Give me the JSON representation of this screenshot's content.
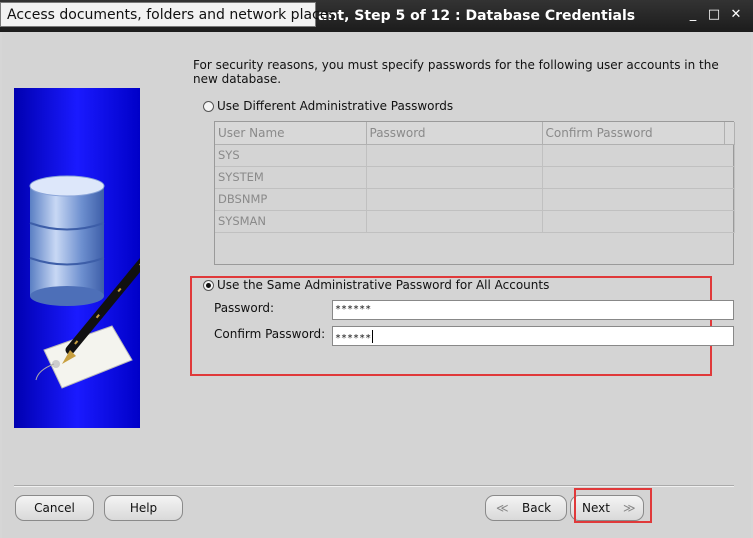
{
  "window": {
    "title": "ant, Step 5 of 12 : Database Credentials",
    "tooltip": "Access documents, folders and network places",
    "minimize_glyph": "_",
    "maximize_glyph": "□",
    "close_glyph": "✕"
  },
  "intro_text": "For security reasons, you must specify passwords for the following user accounts in the new database.",
  "option_different": {
    "label": "Use Different Administrative Passwords",
    "selected": false
  },
  "accounts_table": {
    "columns": [
      "User Name",
      "Password",
      "Confirm Password"
    ],
    "rows": [
      [
        "SYS",
        "",
        ""
      ],
      [
        "SYSTEM",
        "",
        ""
      ],
      [
        "DBSNMP",
        "",
        ""
      ],
      [
        "SYSMAN",
        "",
        ""
      ]
    ]
  },
  "option_same": {
    "label": "Use the Same Administrative Password for All Accounts",
    "selected": true,
    "password_label": "Password:",
    "password_value": "******",
    "confirm_label": "Confirm Password:",
    "confirm_value": "******"
  },
  "buttons": {
    "cancel": "Cancel",
    "help": "Help",
    "back": "Back",
    "next": "Next",
    "back_arrow": "≪",
    "next_arrow": "≫"
  },
  "colors": {
    "highlight": "#e0393a",
    "side_image_blue": "#1a1aff"
  },
  "icons": {
    "side_image": "database-pen-tag-illustration"
  }
}
